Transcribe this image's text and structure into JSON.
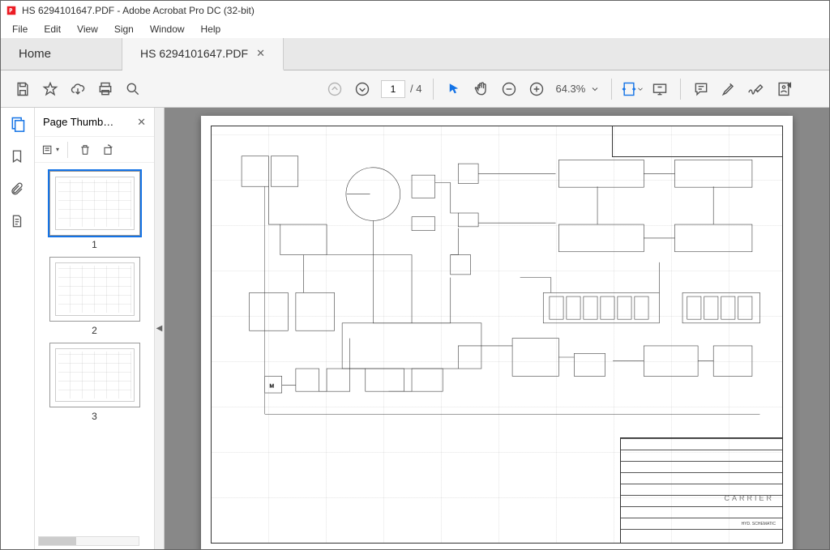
{
  "window": {
    "title": "HS 6294101647.PDF - Adobe Acrobat Pro DC (32-bit)"
  },
  "menu": {
    "file": "File",
    "edit": "Edit",
    "view": "View",
    "sign": "Sign",
    "window": "Window",
    "help": "Help"
  },
  "tabs": {
    "home": "Home",
    "doc": "HS 6294101647.PDF"
  },
  "toolbar": {
    "page_current": "1",
    "page_sep": "/",
    "page_total": "4",
    "zoom": "64.3%"
  },
  "sidebar": {
    "panel_title": "Page Thumb…",
    "thumbs": [
      "1",
      "2",
      "3"
    ]
  },
  "doc": {
    "titleblock_type": "HYD. SCHEMATIC",
    "carrier": "CARRIER"
  }
}
